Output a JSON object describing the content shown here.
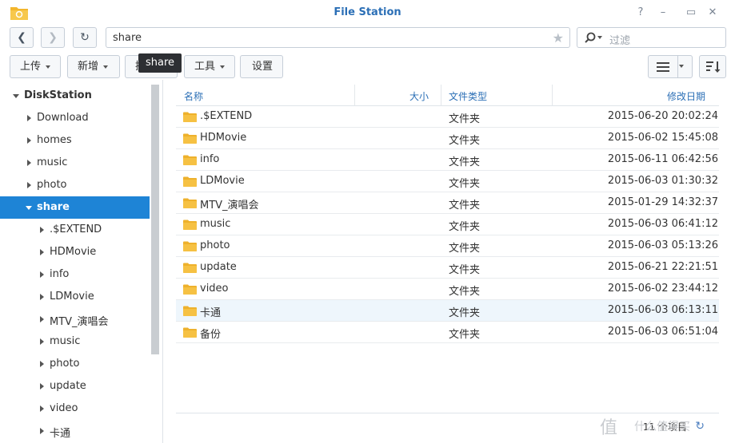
{
  "window": {
    "title": "File Station"
  },
  "nav": {
    "path": "share",
    "search_placeholder": "过滤"
  },
  "toolbar": {
    "upload": "上传",
    "create": "新增",
    "action": "操作",
    "tools": "工具",
    "settings": "设置",
    "tooltip": "share"
  },
  "sidebar": {
    "root": "DiskStation",
    "items": [
      {
        "label": "Download",
        "level": 1,
        "state": "collapsed"
      },
      {
        "label": "homes",
        "level": 1,
        "state": "collapsed"
      },
      {
        "label": "music",
        "level": 1,
        "state": "collapsed"
      },
      {
        "label": "photo",
        "level": 1,
        "state": "collapsed"
      },
      {
        "label": "share",
        "level": 1,
        "state": "expanded",
        "selected": true
      },
      {
        "label": ".$EXTEND",
        "level": 2,
        "state": "collapsed"
      },
      {
        "label": "HDMovie",
        "level": 2,
        "state": "collapsed"
      },
      {
        "label": "info",
        "level": 2,
        "state": "collapsed"
      },
      {
        "label": "LDMovie",
        "level": 2,
        "state": "collapsed"
      },
      {
        "label": "MTV_演唱会",
        "level": 2,
        "state": "collapsed"
      },
      {
        "label": "music",
        "level": 2,
        "state": "collapsed"
      },
      {
        "label": "photo",
        "level": 2,
        "state": "collapsed"
      },
      {
        "label": "update",
        "level": 2,
        "state": "collapsed"
      },
      {
        "label": "video",
        "level": 2,
        "state": "collapsed"
      },
      {
        "label": "卡通",
        "level": 2,
        "state": "collapsed"
      }
    ]
  },
  "list": {
    "columns": {
      "name": "名称",
      "size": "大小",
      "type": "文件类型",
      "modified": "修改日期"
    },
    "rows": [
      {
        "name": ".$EXTEND",
        "type": "文件夹",
        "modified": "2015-06-20 20:02:24"
      },
      {
        "name": "HDMovie",
        "type": "文件夹",
        "modified": "2015-06-02 15:45:08"
      },
      {
        "name": "info",
        "type": "文件夹",
        "modified": "2015-06-11 06:42:56"
      },
      {
        "name": "LDMovie",
        "type": "文件夹",
        "modified": "2015-06-03 01:30:32"
      },
      {
        "name": "MTV_演唱会",
        "type": "文件夹",
        "modified": "2015-01-29 14:32:37"
      },
      {
        "name": "music",
        "type": "文件夹",
        "modified": "2015-06-03 06:41:12"
      },
      {
        "name": "photo",
        "type": "文件夹",
        "modified": "2015-06-03 05:13:26"
      },
      {
        "name": "update",
        "type": "文件夹",
        "modified": "2015-06-21 22:21:51"
      },
      {
        "name": "video",
        "type": "文件夹",
        "modified": "2015-06-02 23:44:12"
      },
      {
        "name": "卡通",
        "type": "文件夹",
        "modified": "2015-06-03 06:13:11",
        "highlighted": true
      },
      {
        "name": "备份",
        "type": "文件夹",
        "modified": "2015-06-03 06:51:04"
      }
    ],
    "footer": "11 个项目"
  },
  "watermark": {
    "text": "什么值得买"
  },
  "colors": {
    "accent": "#1e84d6",
    "title": "#2b6fb6",
    "folder": "#f6c143"
  }
}
